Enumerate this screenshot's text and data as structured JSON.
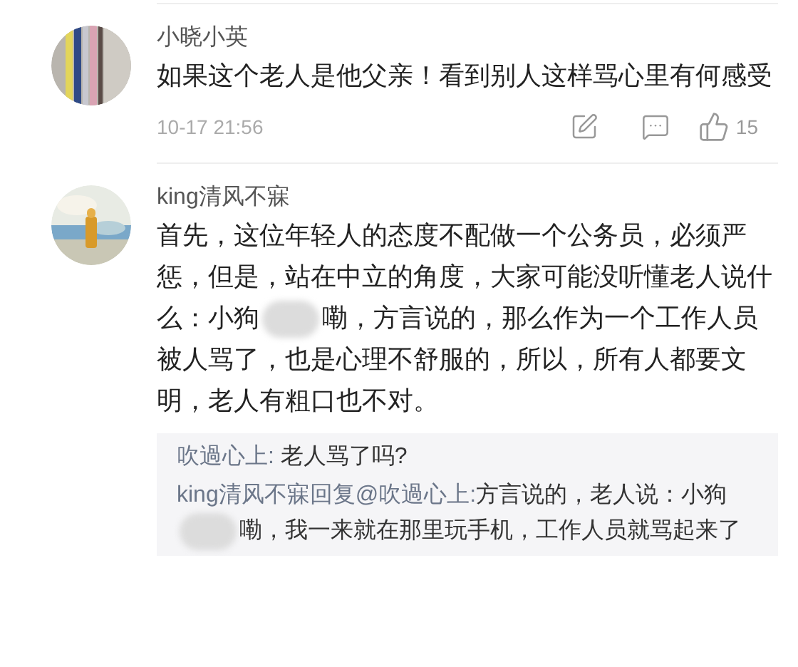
{
  "comments": [
    {
      "username": "小晓小英",
      "avatar": {
        "kind": "picture"
      },
      "body": [
        {
          "kind": "text",
          "text": "如果这个老人是他父亲！看到别人这样骂心里有何感受"
        }
      ],
      "time": "10-17 21:56",
      "likes": "15"
    },
    {
      "username": "king清风不寐",
      "avatar": {
        "kind": "picture"
      },
      "body": [
        {
          "kind": "text",
          "text": "首先，这位年轻人的态度不配做一个公务员，必须严惩，但是，站在中立的角度，大家可能没听懂老人说什么：小狗"
        },
        {
          "kind": "censored"
        },
        {
          "kind": "text",
          "text": "嘞，方言说的，那么作为一个工作人员被人骂了，也是心理不舒服的，所以，所有人都要文明，老人有粗口也不对。"
        }
      ],
      "replies": [
        {
          "author": "吹過心上: ",
          "body": [
            {
              "kind": "text",
              "text": "老人骂了吗?"
            }
          ]
        },
        {
          "author": "king清风不寐回复@吹過心上:",
          "body": [
            {
              "kind": "text",
              "text": "方言说的，老人说：小狗"
            },
            {
              "kind": "censored"
            },
            {
              "kind": "text",
              "text": "嘞，我一来就在那里玩手机，工作人员就骂起来了"
            }
          ]
        }
      ]
    }
  ]
}
